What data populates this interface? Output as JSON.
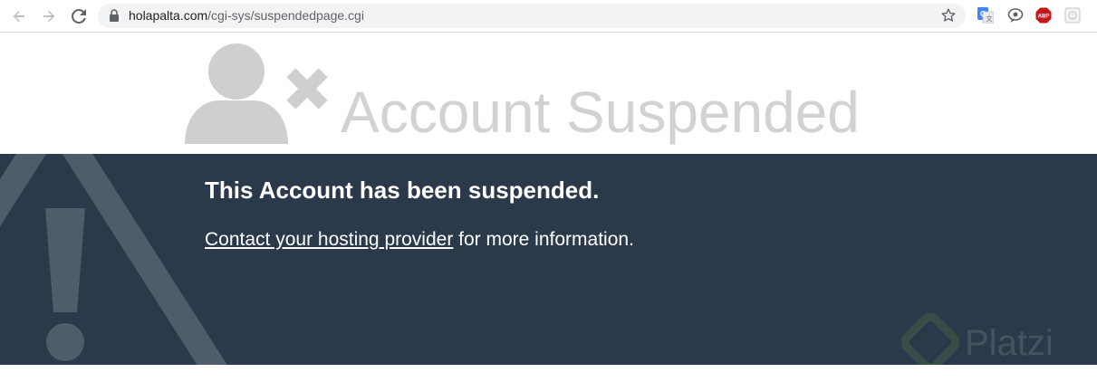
{
  "browser": {
    "url_host": "holapalta.com",
    "url_path": "/cgi-sys/suspendedpage.cgi",
    "icons": {
      "back": "back-arrow-icon",
      "forward": "forward-arrow-icon",
      "reload": "reload-icon",
      "lock": "lock-icon",
      "bookmark": "star-icon",
      "translate": "google-translate-icon",
      "speech": "speech-bubble-icon",
      "adblock": "adblock-plus-icon",
      "extension": "extension-icon"
    },
    "adblock_label": "ABP"
  },
  "page": {
    "title": "Account Suspended",
    "headline": "This Account has been suspended.",
    "contact_link": "Contact your hosting provider",
    "contact_suffix": " for more information.",
    "watermark_text": "Platzi"
  },
  "colors": {
    "band_background": "#2b3a4a",
    "title_gray": "#d2d2d2",
    "icon_gray": "#cfcfcf",
    "warning_shape": "#4f5d6b",
    "text_white": "#ffffff",
    "adblock_red": "#c4161c"
  }
}
